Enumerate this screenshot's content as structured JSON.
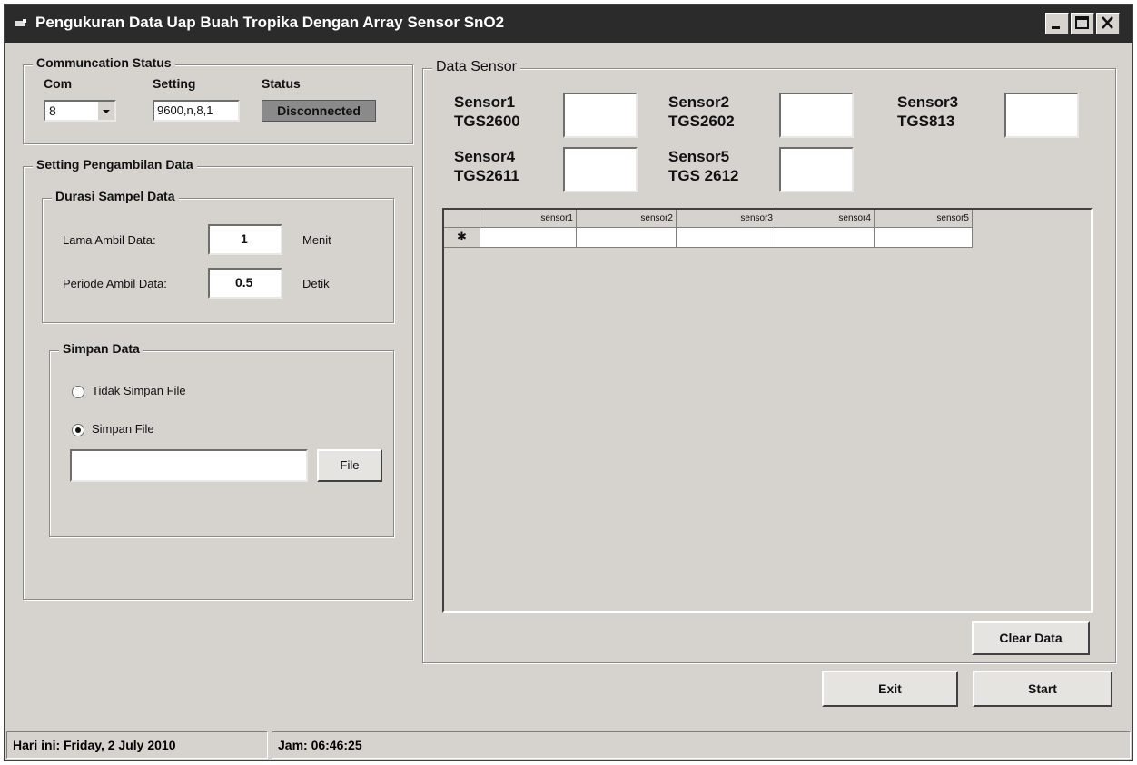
{
  "window": {
    "title": "Pengukuran Data Uap Buah Tropika Dengan Array Sensor SnO2"
  },
  "communication": {
    "label": "Communcation Status",
    "com_label": "Com",
    "com_value": "8",
    "setting_label": "Setting",
    "setting_value": "9600,n,8,1",
    "status_label": "Status",
    "status_value": "Disconnected"
  },
  "setting": {
    "label": "Setting Pengambilan Data",
    "durasi": {
      "label": "Durasi Sampel Data",
      "lama_label": "Lama Ambil Data:",
      "lama_value": "1",
      "lama_unit": "Menit",
      "periode_label": "Periode Ambil Data:",
      "periode_value": "0.5",
      "periode_unit": "Detik"
    },
    "simpan": {
      "label": "Simpan Data",
      "option1": "Tidak Simpan File",
      "option2": "Simpan File",
      "selected": "Simpan File",
      "file_path": "",
      "file_button": "File"
    }
  },
  "data_sensor": {
    "label": "Data Sensor",
    "sensors": [
      {
        "name": "Sensor1",
        "type": "TGS2600",
        "value": ""
      },
      {
        "name": "Sensor2",
        "type": "TGS2602",
        "value": ""
      },
      {
        "name": "Sensor3",
        "type": "TGS813",
        "value": ""
      },
      {
        "name": "Sensor4",
        "type": "TGS2611",
        "value": ""
      },
      {
        "name": "Sensor5",
        "type": "TGS 2612",
        "value": ""
      }
    ],
    "grid": {
      "columns": [
        "sensor1",
        "sensor2",
        "sensor3",
        "sensor4",
        "sensor5"
      ],
      "new_row_marker": "✱"
    },
    "clear_button": "Clear Data"
  },
  "buttons": {
    "exit": "Exit",
    "start": "Start"
  },
  "statusbar": {
    "date": "Hari ini: Friday, 2 July 2010",
    "time": "Jam: 06:46:25"
  }
}
